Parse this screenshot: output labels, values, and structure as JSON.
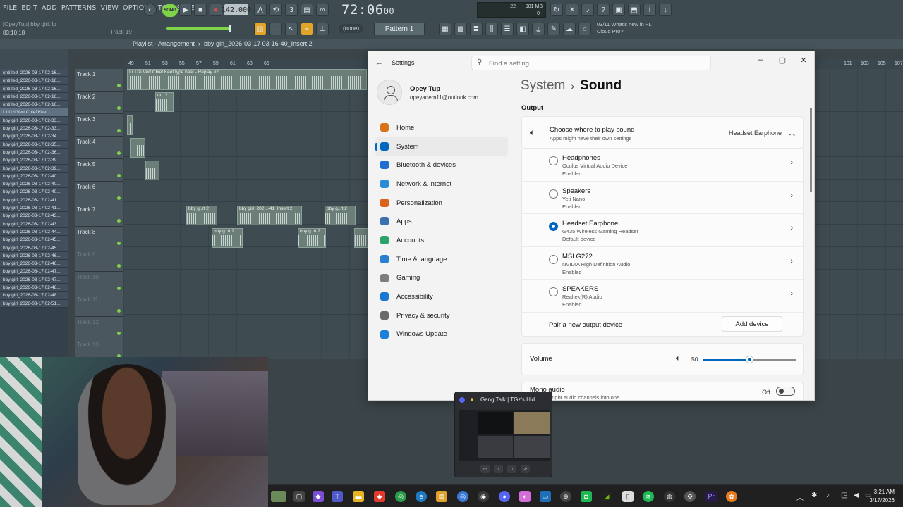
{
  "fl": {
    "menu": [
      "FILE",
      "EDIT",
      "ADD",
      "PATTERNS",
      "VIEW",
      "OPTIONS",
      "TOOLS",
      "HELP"
    ],
    "project": "[OpeyTup] bby girl.flp",
    "position": "83:10:18",
    "track_hint": "Track 19",
    "song_mode": "SONG",
    "bpm": "142.000",
    "time_main": "72:06",
    "time_sub": "00",
    "mem_value": "22",
    "mem_mb": "981 MB",
    "mem_zero": "0",
    "pattern_source": "(none)",
    "pattern": "Pattern 1",
    "news_date": "03/11",
    "news_text": "What's new in FL",
    "news_text2": "Cloud Pro?"
  },
  "playlist": {
    "title": "Playlist - Arrangement",
    "crumb": "bby girl_2026-03-17 03-16-40_Insert 2",
    "ruler": [
      "49",
      "51",
      "53",
      "55",
      "57",
      "59",
      "61",
      "63",
      "65",
      "101",
      "103",
      "105",
      "107"
    ],
    "clips_panel": [
      "untitled_2026-03-17 02-16...",
      "untitled_2026-03-17 02-16...",
      "untitled_2026-03-17 02-16...",
      "untitled_2026-03-17 02-16...",
      "untitled_2026-03-17 02-16...",
      "Lil Uzi Vert  Chief Keef t...",
      "bby girl_2026-03-17 02-33...",
      "bby girl_2026-03-17 02-33...",
      "bby girl_2026-03-17 02-34...",
      "bby girl_2026-03-17 02-35...",
      "bby girl_2026-03-17 02-36...",
      "bby girl_2026-03-17 02-39...",
      "bby girl_2026-03-17 02-39...",
      "bby girl_2026-03-17 02-40...",
      "bby girl_2026-03-17 02-40...",
      "bby girl_2026-03-17 02-40...",
      "bby girl_2026-03-17 02-41...",
      "bby girl_2026-03-17 02-41...",
      "bby girl_2026-03-17 02-43...",
      "bby girl_2026-03-17 02-43...",
      "bby girl_2026-03-17 02-44...",
      "bby girl_2026-03-17 02-45...",
      "bby girl_2026-03-17 02-45...",
      "bby girl_2026-03-17 02-46...",
      "bby girl_2026-03-17 02-46...",
      "bby girl_2026-03-17 02-47...",
      "bby girl_2026-03-17 02-47...",
      "bby girl_2026-03-17 02-48...",
      "bby girl_2026-03-17 02-48...",
      "bby girl_2026-03-17 02-51..."
    ],
    "tracks": [
      "Track 1",
      "Track 2",
      "Track 3",
      "Track 4",
      "Track 5",
      "Track 6",
      "Track 7",
      "Track 8",
      "Track 9",
      "Track 10",
      "Track 11",
      "Track 12",
      "Track 13"
    ],
    "clip_labels": {
      "t1": "Lil Uzi Vert  Chief Keef type beat - Replay #2",
      "t2": "un..2",
      "t7a": "bby g..rt 2",
      "t7b": "bby girl_202...-41_Insert 2",
      "t7c": "bby g..rt 2",
      "t8a": "bby g..rt 2",
      "t8b": "bby g..rt 2"
    }
  },
  "settings": {
    "window_title": "Settings",
    "search_placeholder": "Find a setting",
    "user_name": "Opey Tup",
    "user_email": "opeyadem11@outlook.com",
    "nav": [
      {
        "label": "Home",
        "color": "#d9731a"
      },
      {
        "label": "System",
        "color": "#0067c0"
      },
      {
        "label": "Bluetooth & devices",
        "color": "#1f6fd1"
      },
      {
        "label": "Network & internet",
        "color": "#2a8ad4"
      },
      {
        "label": "Personalization",
        "color": "#d9621f"
      },
      {
        "label": "Apps",
        "color": "#3a6fb0"
      },
      {
        "label": "Accounts",
        "color": "#2ba36a"
      },
      {
        "label": "Time & language",
        "color": "#2a7fd0"
      },
      {
        "label": "Gaming",
        "color": "#7d7d7d"
      },
      {
        "label": "Accessibility",
        "color": "#1b76d1"
      },
      {
        "label": "Privacy & security",
        "color": "#6a6a6a"
      },
      {
        "label": "Windows Update",
        "color": "#1f7fd6"
      }
    ],
    "breadcrumb_parent": "System",
    "breadcrumb_sep": "›",
    "breadcrumb_current": "Sound",
    "output_heading": "Output",
    "choose_title": "Choose where to play sound",
    "choose_sub": "Apps might have their own settings",
    "choose_value": "Headset Earphone",
    "devices": [
      {
        "name": "Headphones",
        "desc": "Oculus Virtual Audio Device",
        "status": "Enabled",
        "selected": false
      },
      {
        "name": "Speakers",
        "desc": "Yeti Nano",
        "status": "Enabled",
        "selected": false
      },
      {
        "name": "Headset Earphone",
        "desc": "G435 Wireless Gaming Headset",
        "status": "Default device",
        "selected": true
      },
      {
        "name": "MSI G272",
        "desc": "NVIDIA High Definition Audio",
        "status": "Enabled",
        "selected": false
      },
      {
        "name": "SPEAKERS",
        "desc": "Realtek(R) Audio",
        "status": "Enabled",
        "selected": false
      }
    ],
    "pair_label": "Pair a new output device",
    "add_device": "Add device",
    "volume_label": "Volume",
    "volume_value": "50",
    "volume_fraction": 0.5,
    "mono_title": "Mono audio",
    "mono_sub": "...eft and right audio channels into one",
    "mono_state": "Off"
  },
  "popup": {
    "title": "Gang Talk | TGz's Hid..."
  },
  "taskbar": {
    "time": "3:21 AM",
    "date": "3/17/2026"
  },
  "colors": {
    "accent": "#0067c0",
    "fl_green": "#7fd44a"
  }
}
